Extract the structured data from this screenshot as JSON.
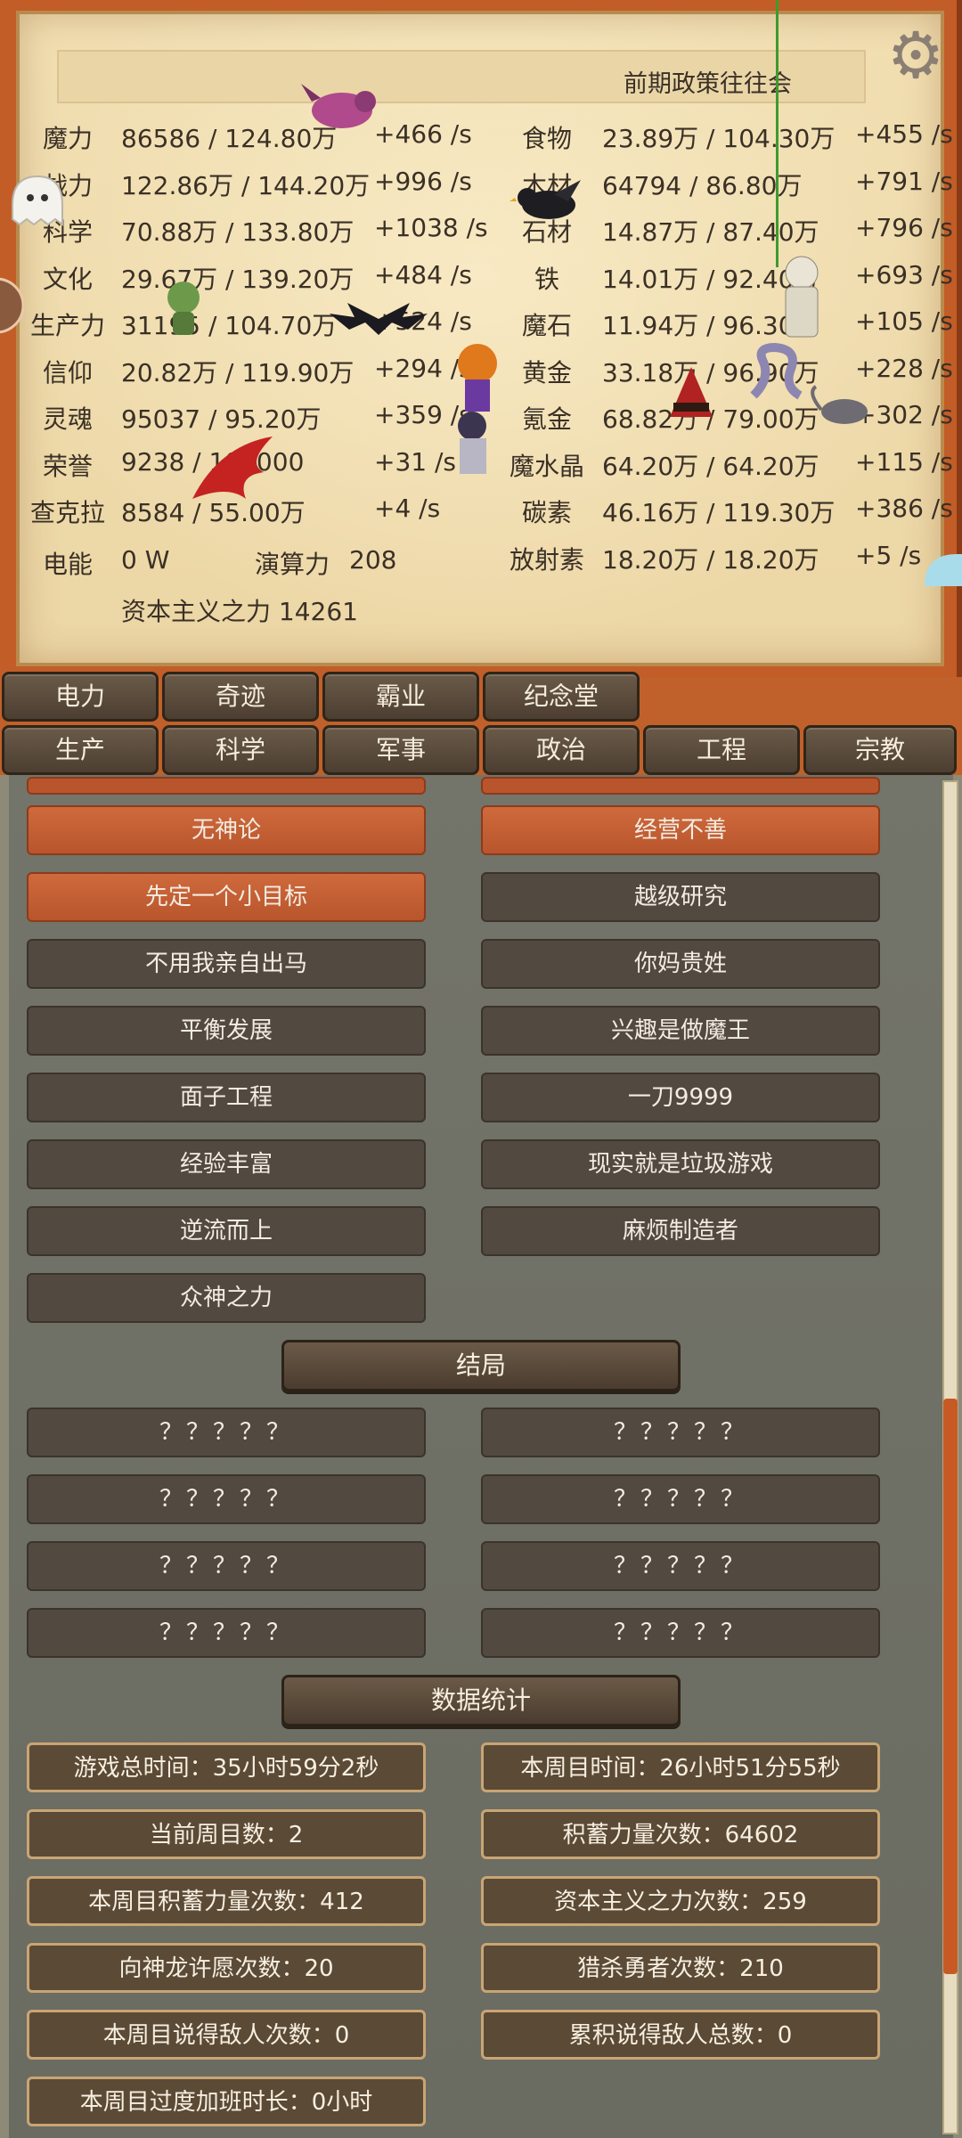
{
  "header": {
    "policy": "前期政策往往会",
    "settings_icon": "gear-icon"
  },
  "stats": {
    "left": [
      {
        "label": "魔力",
        "value": "86586 / 124.80万",
        "rate": "+466 /s"
      },
      {
        "label": "战力",
        "value": "122.86万 / 144.20万",
        "rate": "+996 /s"
      },
      {
        "label": "科学",
        "value": "70.88万 / 133.80万",
        "rate": "+1038 /s"
      },
      {
        "label": "文化",
        "value": "29.67万 / 139.20万",
        "rate": "+484 /s"
      },
      {
        "label": "生产力",
        "value": "31195 / 104.70万",
        "rate": "+524 /s"
      },
      {
        "label": "信仰",
        "value": "20.82万 / 119.90万",
        "rate": "+294 /s"
      },
      {
        "label": "灵魂",
        "value": "95037 / 95.20万",
        "rate": "+359 /s"
      },
      {
        "label": "荣誉",
        "value": "9238 / 100000",
        "rate": "+31 /s"
      },
      {
        "label": "查克拉",
        "value": "8584 / 55.00万",
        "rate": "+4 /s"
      }
    ],
    "right": [
      {
        "label": "食物",
        "value": "23.89万 / 104.30万",
        "rate": "+455 /s"
      },
      {
        "label": "木材",
        "value": "64794 / 86.80万",
        "rate": "+791 /s"
      },
      {
        "label": "石材",
        "value": "14.87万 / 87.40万",
        "rate": "+796 /s"
      },
      {
        "label": "铁",
        "value": "14.01万 / 92.40万",
        "rate": "+693 /s"
      },
      {
        "label": "魔石",
        "value": "11.94万 / 96.30万",
        "rate": "+105 /s"
      },
      {
        "label": "黄金",
        "value": "33.18万 / 96.90万",
        "rate": "+228 /s"
      },
      {
        "label": "氪金",
        "value": "68.82万 / 79.00万",
        "rate": "+302 /s"
      },
      {
        "label": "魔水晶",
        "value": "64.20万 / 64.20万",
        "rate": "+115 /s"
      },
      {
        "label": "碳素",
        "value": "46.16万 / 119.30万",
        "rate": "+386 /s"
      },
      {
        "label": "放射素",
        "value": "18.20万 / 18.20万",
        "rate": "+5 /s"
      }
    ],
    "electric": {
      "label": "电能",
      "value": "0 W"
    },
    "compute": {
      "label": "演算力",
      "value": "208"
    },
    "capital": "资本主义之力 14261"
  },
  "tabs_row1": [
    "电力",
    "奇迹",
    "霸业",
    "纪念堂"
  ],
  "tabs_row2": [
    "生产",
    "科学",
    "军事",
    "政治",
    "工程",
    "宗教"
  ],
  "policies": [
    [
      "无神论",
      "经营不善"
    ],
    [
      "先定一个小目标",
      "越级研究"
    ],
    [
      "不用我亲自出马",
      "你妈贵姓"
    ],
    [
      "平衡发展",
      "兴趣是做魔王"
    ],
    [
      "面子工程",
      "一刀9999"
    ],
    [
      "经验丰富",
      "现实就是垃圾游戏"
    ],
    [
      "逆流而上",
      "麻烦制造者"
    ],
    [
      "众神之力",
      ""
    ]
  ],
  "endings_title": "结局",
  "endings": [
    [
      "？？？？？",
      "？？？？？"
    ],
    [
      "？？？？？",
      "？？？？？"
    ],
    [
      "？？？？？",
      "？？？？？"
    ],
    [
      "？？？？？",
      "？？？？？"
    ]
  ],
  "statistics_title": "数据统计",
  "statistics": [
    [
      "游戏总时间：35小时59分2秒",
      "本周目时间：26小时51分55秒"
    ],
    [
      "当前周目数：2",
      "积蓄力量次数：64602"
    ],
    [
      "本周目积蓄力量次数：412",
      "资本主义之力次数：259"
    ],
    [
      "向神龙许愿次数：20",
      "猎杀勇者次数：210"
    ],
    [
      "本周目说得敌人次数：0",
      "累积说得敌人总数：0"
    ],
    [
      "本周目过度加班时长：0小时",
      ""
    ]
  ]
}
